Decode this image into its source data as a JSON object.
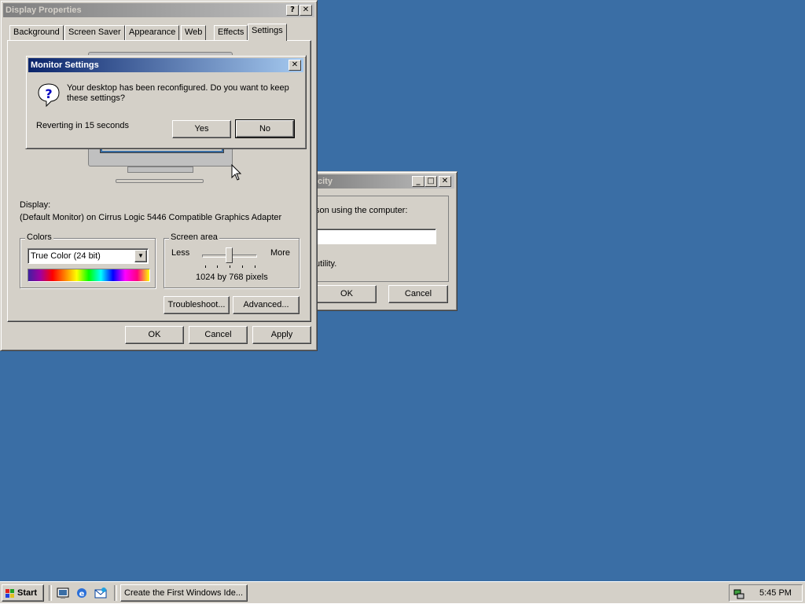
{
  "desktop": {
    "color": "#3a6ea5"
  },
  "display_properties": {
    "title": "Display Properties",
    "help_btn": "?",
    "close_btn": "✕",
    "tabs": [
      {
        "label": "Background"
      },
      {
        "label": "Screen Saver"
      },
      {
        "label": "Appearance"
      },
      {
        "label": "Web"
      },
      {
        "label": "Effects"
      },
      {
        "label": "Settings"
      }
    ],
    "active_tab": "Settings",
    "display_label": "Display:",
    "display_value": "(Default Monitor) on Cirrus Logic 5446 Compatible Graphics Adapter",
    "colors": {
      "label": "Colors",
      "selected": "True Color (24 bit)"
    },
    "screen_area": {
      "label": "Screen area",
      "less": "Less",
      "more": "More",
      "value_text": "1024 by 768 pixels",
      "slider_position": 0.5
    },
    "troubleshoot_btn": "Troubleshoot...",
    "advanced_btn": "Advanced...",
    "ok_btn": "OK",
    "cancel_btn": "Cancel",
    "apply_btn": "Apply"
  },
  "monitor_settings": {
    "title": "Monitor Settings",
    "close_btn": "✕",
    "message": "Your desktop has been reconfigured.  Do you want to keep these settings?",
    "countdown": "Reverting in 15 seconds",
    "yes_btn": "Yes",
    "no_btn": "No"
  },
  "background_window": {
    "title_fragment": "city",
    "text_fragment": "son using the computer:",
    "utility_fragment": "utility.",
    "ok_btn": "OK",
    "cancel_btn": "Cancel"
  },
  "taskbar": {
    "start_label": "Start",
    "task_label": "Create the First Windows Ide...",
    "clock": "5:45 PM",
    "quicklaunch": [
      "show-desktop-icon",
      "internet-explorer-icon",
      "outlook-express-icon"
    ]
  }
}
